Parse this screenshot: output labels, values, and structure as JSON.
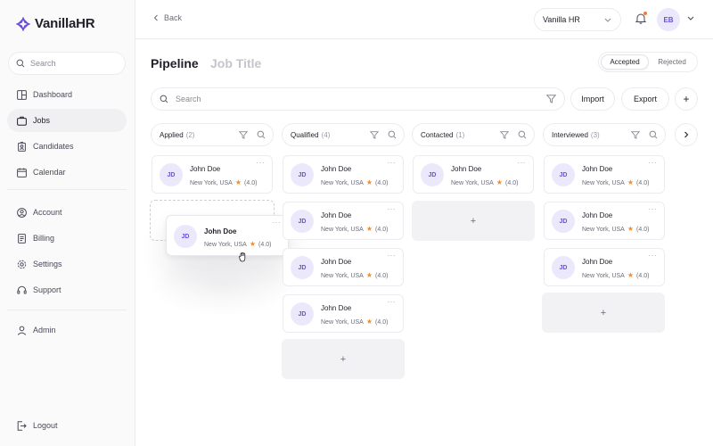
{
  "app": {
    "name": "VanillaHR"
  },
  "sidebar": {
    "search_placeholder": "Search",
    "items": [
      {
        "label": "Dashboard",
        "icon": "layout-icon"
      },
      {
        "label": "Jobs",
        "icon": "briefcase-icon",
        "active": true
      },
      {
        "label": "Candidates",
        "icon": "badge-icon"
      },
      {
        "label": "Calendar",
        "icon": "calendar-icon"
      },
      {
        "label": "Account",
        "icon": "user-circle-icon"
      },
      {
        "label": "Billing",
        "icon": "receipt-icon"
      },
      {
        "label": "Settings",
        "icon": "gear-icon"
      },
      {
        "label": "Support",
        "icon": "headset-icon"
      },
      {
        "label": "Admin",
        "icon": "user-icon"
      }
    ],
    "logout": "Logout"
  },
  "header": {
    "back": "Back",
    "company": "Vanilla HR",
    "user_initials": "EB"
  },
  "page": {
    "title": "Pipeline",
    "subtitle": "Job Title",
    "segments": [
      "Accepted",
      "Rejected"
    ],
    "active_segment": "Accepted"
  },
  "toolbar": {
    "search_placeholder": "Search",
    "import": "Import",
    "export": "Export",
    "add": "+"
  },
  "columns": [
    {
      "name": "Applied",
      "count": "(2)"
    },
    {
      "name": "Qualified",
      "count": "(4)"
    },
    {
      "name": "Contacted",
      "count": "(1)"
    },
    {
      "name": "Interviewed",
      "count": "(3)"
    }
  ],
  "card": {
    "initials": "JD",
    "name": "John Doe",
    "location": "New York, USA",
    "rating": "(4.0)",
    "more": "···"
  },
  "add_tile": "+",
  "colors": {
    "accent": "#6b4fd8",
    "avatar_bg": "#ece8fb",
    "star": "#f28c28",
    "notification": "#f57a33"
  }
}
